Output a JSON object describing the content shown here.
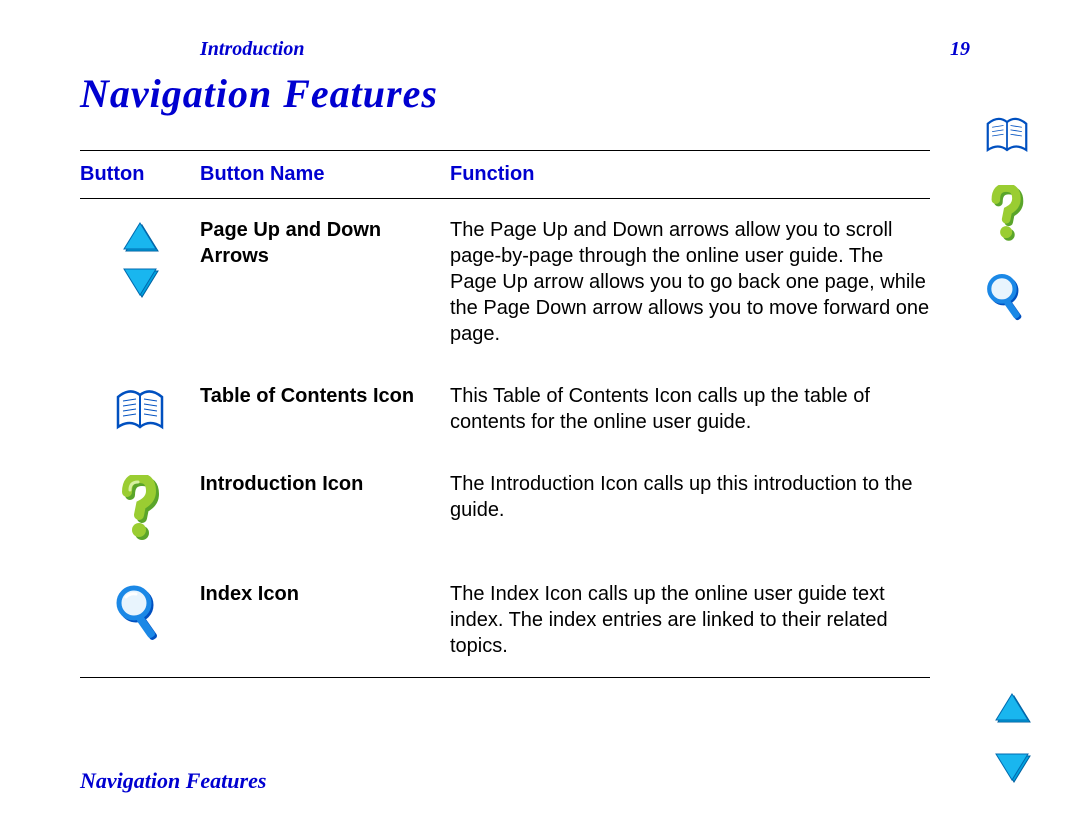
{
  "header": {
    "section": "Introduction",
    "page_number": "19"
  },
  "title": "Navigation Features",
  "footer": "Navigation Features",
  "table": {
    "columns": [
      "Button",
      "Button Name",
      "Function"
    ],
    "rows": [
      {
        "icon": "page-up-down",
        "name": "Page Up and Down Arrows",
        "function": "The Page Up and Down arrows allow you to scroll page-by-page through the online user guide. The Page Up arrow allows you to go back one page, while the Page Down arrow allows you to move forward one page."
      },
      {
        "icon": "book",
        "name": "Table of Contents Icon",
        "function": "This Table of Contents Icon calls up the table of contents for the online user guide."
      },
      {
        "icon": "question",
        "name": "Introduction Icon",
        "function": "The Introduction Icon calls up this introduction to the guide."
      },
      {
        "icon": "magnifier",
        "name": "Index Icon",
        "function": "The Index Icon calls up the online user guide text index. The index entries are linked to their related topics."
      }
    ]
  },
  "sidebar": {
    "top_icons": [
      "book",
      "question",
      "magnifier"
    ],
    "bottom_icons": [
      "arrow-up",
      "arrow-down"
    ]
  },
  "colors": {
    "brand_blue": "#0000d0",
    "icon_cyan": "#00a3e0",
    "icon_lime": "#9acd32"
  }
}
